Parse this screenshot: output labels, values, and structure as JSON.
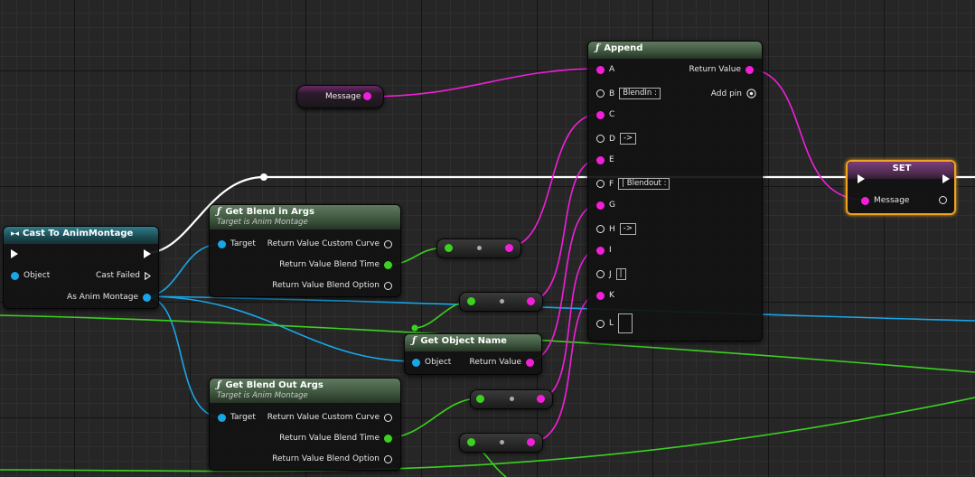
{
  "nodes": {
    "message_var": {
      "label": "Message"
    },
    "cast": {
      "title": "Cast To AnimMontage",
      "object_pin": "Object",
      "cast_failed_pin": "Cast Failed",
      "as_anim_montage_pin": "As Anim Montage"
    },
    "get_blend_in": {
      "title": "Get Blend in Args",
      "subtitle": "Target is Anim Montage",
      "target_pin": "Target",
      "curve_pin": "Return Value Custom Curve",
      "time_pin": "Return Value Blend Time",
      "option_pin": "Return Value Blend Option"
    },
    "get_blend_out": {
      "title": "Get Blend Out Args",
      "subtitle": "Target is Anim Montage",
      "target_pin": "Target",
      "curve_pin": "Return Value Custom Curve",
      "time_pin": "Return Value Blend Time",
      "option_pin": "Return Value Blend Option"
    },
    "get_object_name": {
      "title": "Get Object Name",
      "object_pin": "Object",
      "return_pin": "Return Value"
    },
    "append": {
      "title": "Append",
      "return_pin": "Return Value",
      "add_pin": "Add pin",
      "pins": [
        {
          "label": "A",
          "connected": true,
          "value": ""
        },
        {
          "label": "B",
          "connected": false,
          "value": "BlendIn :"
        },
        {
          "label": "C",
          "connected": true,
          "value": ""
        },
        {
          "label": "D",
          "connected": false,
          "value": "->"
        },
        {
          "label": "E",
          "connected": true,
          "value": ""
        },
        {
          "label": "F",
          "connected": false,
          "value": "| Blendout :"
        },
        {
          "label": "G",
          "connected": true,
          "value": ""
        },
        {
          "label": "H",
          "connected": false,
          "value": "->"
        },
        {
          "label": "I",
          "connected": true,
          "value": ""
        },
        {
          "label": "J",
          "connected": false,
          "value": "|"
        },
        {
          "label": "K",
          "connected": true,
          "value": ""
        },
        {
          "label": "L",
          "connected": false,
          "value": ""
        }
      ]
    },
    "set": {
      "title": "SET",
      "message_pin": "Message"
    }
  },
  "colors": {
    "string": "#f21fd9",
    "object": "#17a7e8",
    "float": "#3bd21f",
    "exec": "#ffffff",
    "selection": "#f0a320"
  },
  "icons": {
    "function": "f-function-icon",
    "cast": "cast-arrows-icon",
    "add_pin": "plus-circle-icon"
  }
}
